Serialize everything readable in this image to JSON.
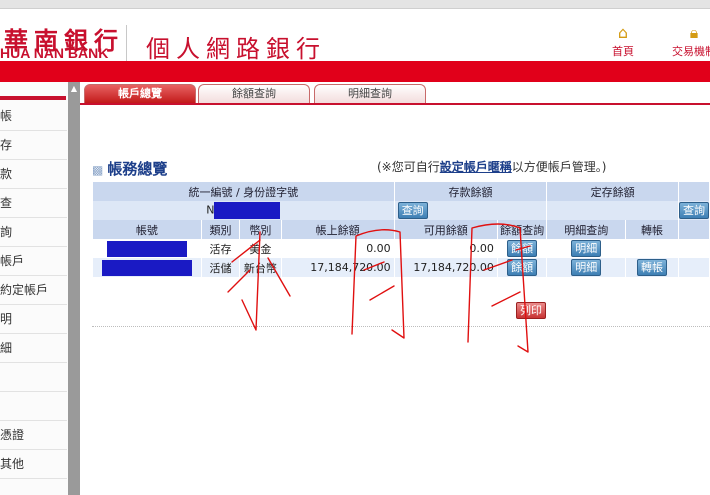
{
  "header": {
    "bank_name_cn": "華南銀行",
    "bank_name_en": "HUA NAN BANK",
    "service_title": "個人網路銀行",
    "home_label": "首頁",
    "trade_label": "交易機制"
  },
  "sidebar": {
    "items": [
      {
        "label": "帳"
      },
      {
        "label": "存"
      },
      {
        "label": "款"
      },
      {
        "label": "查"
      },
      {
        "label": "詢"
      },
      {
        "label": "帳戶"
      },
      {
        "label": "約定帳戶"
      },
      {
        "label": "明"
      },
      {
        "label": "細"
      },
      {
        "label": ""
      },
      {
        "label": ""
      },
      {
        "label": "憑證"
      },
      {
        "label": "其他"
      }
    ]
  },
  "tabs": [
    {
      "label": "帳戶總覽",
      "active": true
    },
    {
      "label": "餘額查詢",
      "active": false
    },
    {
      "label": "明細查詢",
      "active": false
    }
  ],
  "section": {
    "title": "帳務總覽",
    "note_prefix": "(※您可自行",
    "note_link": "設定帳戶暱稱",
    "note_suffix": "以方便帳戶管理。)"
  },
  "summary": {
    "id_header": "統一編號 / 身份證字號",
    "deposit_header": "存款餘額",
    "time_deposit_header": "定存餘額",
    "id_value_prefix": "N",
    "query_label": "查詢"
  },
  "columns": [
    "帳號",
    "類別",
    "幣別",
    "帳上餘額",
    "可用餘額",
    "餘額查詢",
    "明細查詢",
    "轉帳"
  ],
  "accounts": [
    {
      "type": "活存",
      "currency": "美金",
      "book_balance": "0.00",
      "available_balance": "0.00",
      "balance_btn": "餘額",
      "detail_btn": "明細",
      "transfer_btn": ""
    },
    {
      "type": "活儲",
      "currency": "新台幣",
      "book_balance": "17,184,720.00",
      "available_balance": "17,184,720.00",
      "balance_btn": "餘額",
      "detail_btn": "明細",
      "transfer_btn": "轉帳"
    }
  ],
  "print_label": "列印",
  "colors": {
    "brand_red": "#e1001a",
    "title_blue": "#1d3f8a",
    "header_blue": "#c9d7ee",
    "mask_blue": "#1a1ac4"
  }
}
